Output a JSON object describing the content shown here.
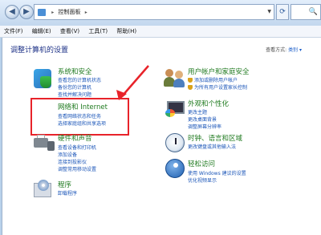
{
  "address": {
    "crumbs": [
      "控制面板"
    ]
  },
  "search": {
    "glyph": "🔍"
  },
  "menu": [
    "文件(F)",
    "编辑(E)",
    "查看(V)",
    "工具(T)",
    "帮助(H)"
  ],
  "main": {
    "heading": "调整计算机的设置",
    "view_label": "查看方式:",
    "view_value": "类别 ▾"
  },
  "categories": {
    "system": {
      "title": "系统和安全",
      "links": [
        "查看您的计算机状态",
        "备份您的计算机",
        "查找并解决问题"
      ]
    },
    "network": {
      "title": "网络和 Internet",
      "links": [
        "查看网络状态和任务",
        "选择家庭组和共享选项"
      ]
    },
    "hardware": {
      "title": "硬件和声音",
      "links": [
        "查看设备和打印机",
        "添加设备",
        "连接到投影仪",
        "调整常用移动设置"
      ]
    },
    "programs": {
      "title": "程序",
      "links": [
        "卸载程序"
      ]
    },
    "users": {
      "title": "用户帐户和家庭安全",
      "links": [
        "添加或删除用户帐户",
        "为所有用户设置家长控制"
      ]
    },
    "appearance": {
      "title": "外观和个性化",
      "links": [
        "更改主题",
        "更改桌面背景",
        "调整屏幕分辨率"
      ]
    },
    "clock": {
      "title": "时钟、语言和区域",
      "links": [
        "更改键盘或其他输入法"
      ]
    },
    "ease": {
      "title": "轻松访问",
      "links": [
        "使用 Windows 建议的设置",
        "优化视频显示"
      ]
    }
  },
  "colors": {
    "annotation": "#e8232a",
    "link": "#1a55b8",
    "heading": "#1e3287"
  }
}
